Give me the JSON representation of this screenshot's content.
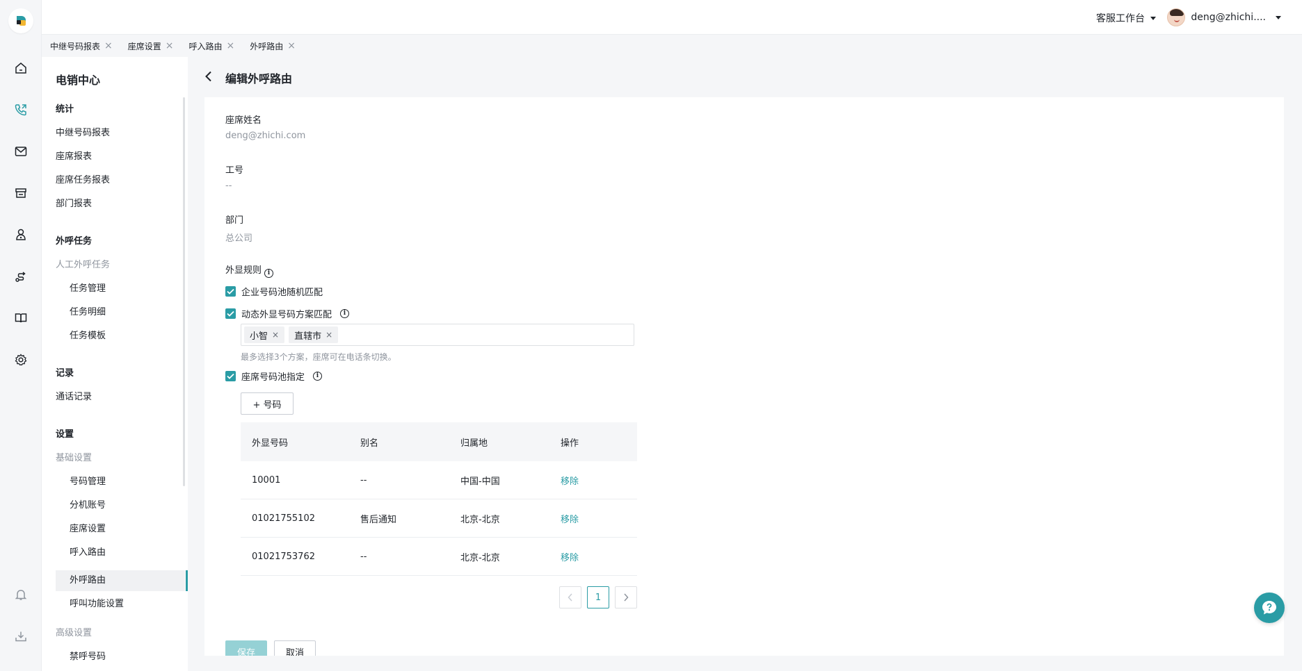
{
  "header": {
    "workspace_label": "客服工作台",
    "user_name": "deng@zhichi...."
  },
  "tabs": [
    {
      "label": "中继号码报表"
    },
    {
      "label": "座席设置"
    },
    {
      "label": "呼入路由"
    },
    {
      "label": "外呼路由"
    }
  ],
  "sidebar": {
    "title": "电销中心",
    "groups": {
      "stats": {
        "label": "统计",
        "items": [
          "中继号码报表",
          "座席报表",
          "座席任务报表",
          "部门报表"
        ]
      },
      "outbound": {
        "label": "外呼任务",
        "sub_label": "人工外呼任务",
        "items": [
          "任务管理",
          "任务明细",
          "任务模板"
        ]
      },
      "records": {
        "label": "记录",
        "items": [
          "通话记录"
        ]
      },
      "settings": {
        "label": "设置",
        "basic_label": "基础设置",
        "basic_items": [
          "号码管理",
          "分机账号",
          "座席设置",
          "呼入路由",
          "外呼路由",
          "呼叫功能设置"
        ],
        "advanced_label": "高级设置",
        "advanced_items": [
          "禁呼号码"
        ]
      }
    }
  },
  "page": {
    "title": "编辑外呼路由",
    "agent_name_label": "座席姓名",
    "agent_name_value": "deng@zhichi.com",
    "job_no_label": "工号",
    "job_no_value": "--",
    "dept_label": "部门",
    "dept_value": "总公司",
    "display_rule_label": "外显规则",
    "rules": [
      {
        "label": "企业号码池随机匹配",
        "checked": true
      },
      {
        "label": "动态外显号码方案匹配",
        "checked": true
      },
      {
        "label": "座席号码池指定",
        "checked": true
      }
    ],
    "schemes": [
      "小智",
      "直辖市"
    ],
    "scheme_hint": "最多选择3个方案，座席可在电话条切换。",
    "add_number_label": "+ 号码",
    "table": {
      "columns": [
        "外显号码",
        "别名",
        "归属地",
        "操作"
      ],
      "rows": [
        {
          "number": "10001",
          "alias": "--",
          "location": "中国-中国",
          "action": "移除"
        },
        {
          "number": "01021755102",
          "alias": "售后通知",
          "location": "北京-北京",
          "action": "移除"
        },
        {
          "number": "01021753762",
          "alias": "--",
          "location": "北京-北京",
          "action": "移除"
        }
      ]
    },
    "pagination": {
      "current": "1"
    },
    "save_label": "保存",
    "cancel_label": "取消"
  },
  "colors": {
    "accent": "#2a9ca5",
    "accent_light": "#95d1d5"
  },
  "icons": [
    "home-icon",
    "phone-icon",
    "mail-icon",
    "store-icon",
    "user-icon",
    "route-icon",
    "book-icon",
    "gear-icon",
    "bell-icon",
    "download-icon",
    "help-icon"
  ]
}
